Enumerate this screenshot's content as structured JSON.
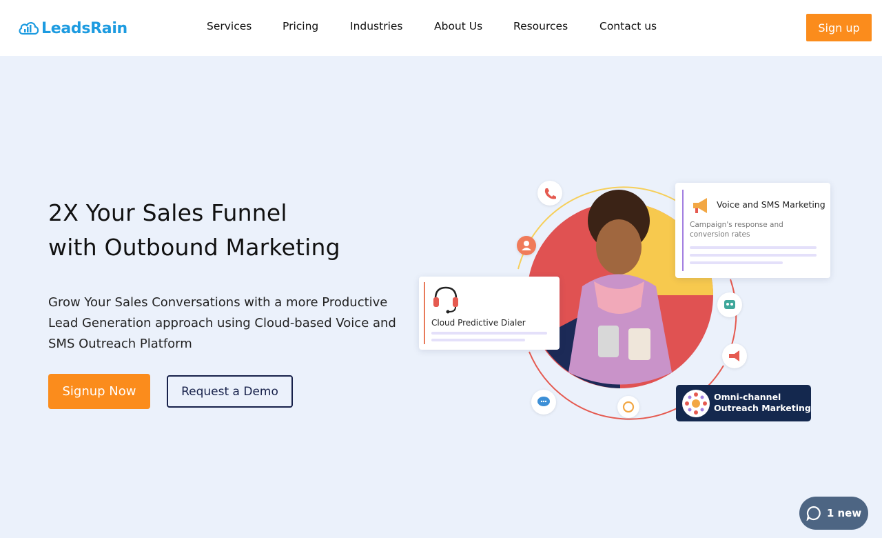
{
  "brand": {
    "name": "LeadsRain",
    "color": "#1d9be0"
  },
  "nav": {
    "items": [
      {
        "label": "Services"
      },
      {
        "label": "Pricing"
      },
      {
        "label": "Industries"
      },
      {
        "label": "About Us"
      },
      {
        "label": "Resources"
      },
      {
        "label": "Contact us"
      }
    ],
    "signup_label": "Sign up"
  },
  "hero": {
    "title_line1": "2X Your Sales Funnel",
    "title_line2": "with Outbound Marketing",
    "subtitle": "Grow Your Sales Conversations with a more Productive Lead Generation approach using Cloud-based Voice and SMS Outreach Platform",
    "primary_cta": "Signup Now",
    "secondary_cta": "Request a Demo"
  },
  "illustration": {
    "voice_card": {
      "title": "Voice and SMS Marketing",
      "desc": "Campaign's response and conversion rates"
    },
    "dialer_card": {
      "title": "Cloud Predictive Dialer"
    },
    "omni_card": {
      "line1": "Omni-channel",
      "line2": "Outreach Marketing"
    },
    "icons": [
      "phone-icon",
      "user-icon",
      "robot-icon",
      "megaphone-icon",
      "refresh-icon",
      "chat-icon"
    ]
  },
  "chat_widget": {
    "label": "1 new"
  },
  "colors": {
    "accent": "#fb8c1c",
    "hero_bg": "#ebf1fb",
    "navy": "#17214a",
    "omni_bg": "#14284e",
    "chat_bg": "#4d6583"
  }
}
